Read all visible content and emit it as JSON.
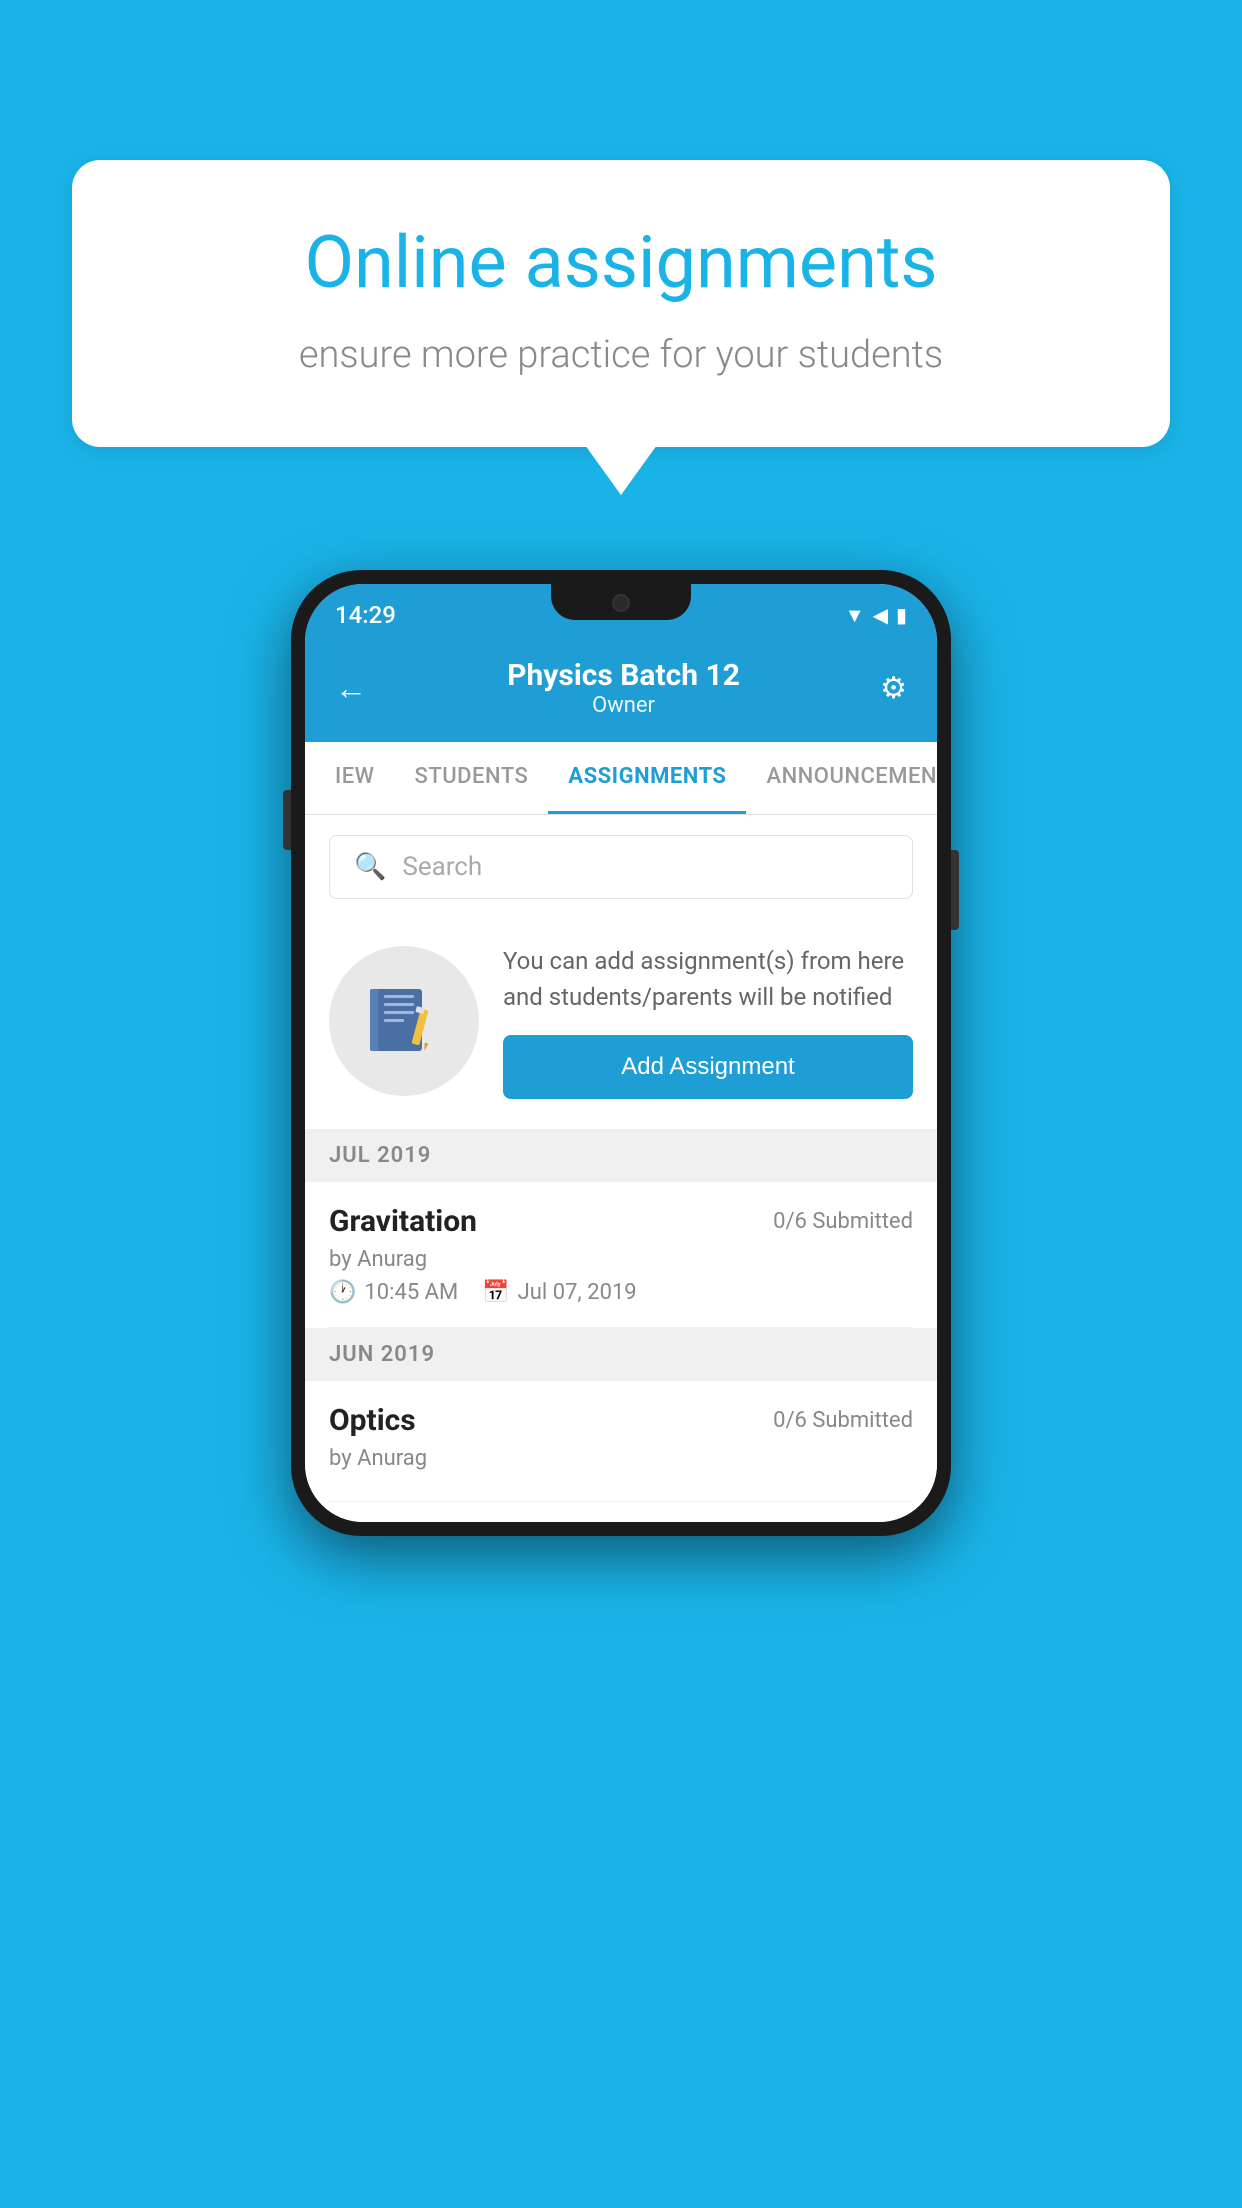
{
  "background_color": "#1ab3e8",
  "speech_bubble": {
    "title": "Online assignments",
    "subtitle": "ensure more practice for your students"
  },
  "phone": {
    "status_bar": {
      "time": "14:29",
      "icons": [
        "wifi",
        "signal",
        "battery"
      ]
    },
    "header": {
      "title": "Physics Batch 12",
      "subtitle": "Owner",
      "back_label": "←",
      "settings_label": "⚙"
    },
    "tabs": [
      {
        "label": "IEW",
        "active": false
      },
      {
        "label": "STUDENTS",
        "active": false
      },
      {
        "label": "ASSIGNMENTS",
        "active": true
      },
      {
        "label": "ANNOUNCEMENTS",
        "active": false
      }
    ],
    "search": {
      "placeholder": "Search"
    },
    "info_section": {
      "text": "You can add assignment(s) from here and students/parents will be notified",
      "add_button_label": "Add Assignment"
    },
    "assignments": [
      {
        "month": "JUL 2019",
        "items": [
          {
            "name": "Gravitation",
            "submitted": "0/6 Submitted",
            "author": "by Anurag",
            "time": "10:45 AM",
            "date": "Jul 07, 2019"
          }
        ]
      },
      {
        "month": "JUN 2019",
        "items": [
          {
            "name": "Optics",
            "submitted": "0/6 Submitted",
            "author": "by Anurag",
            "time": "",
            "date": ""
          }
        ]
      }
    ]
  }
}
